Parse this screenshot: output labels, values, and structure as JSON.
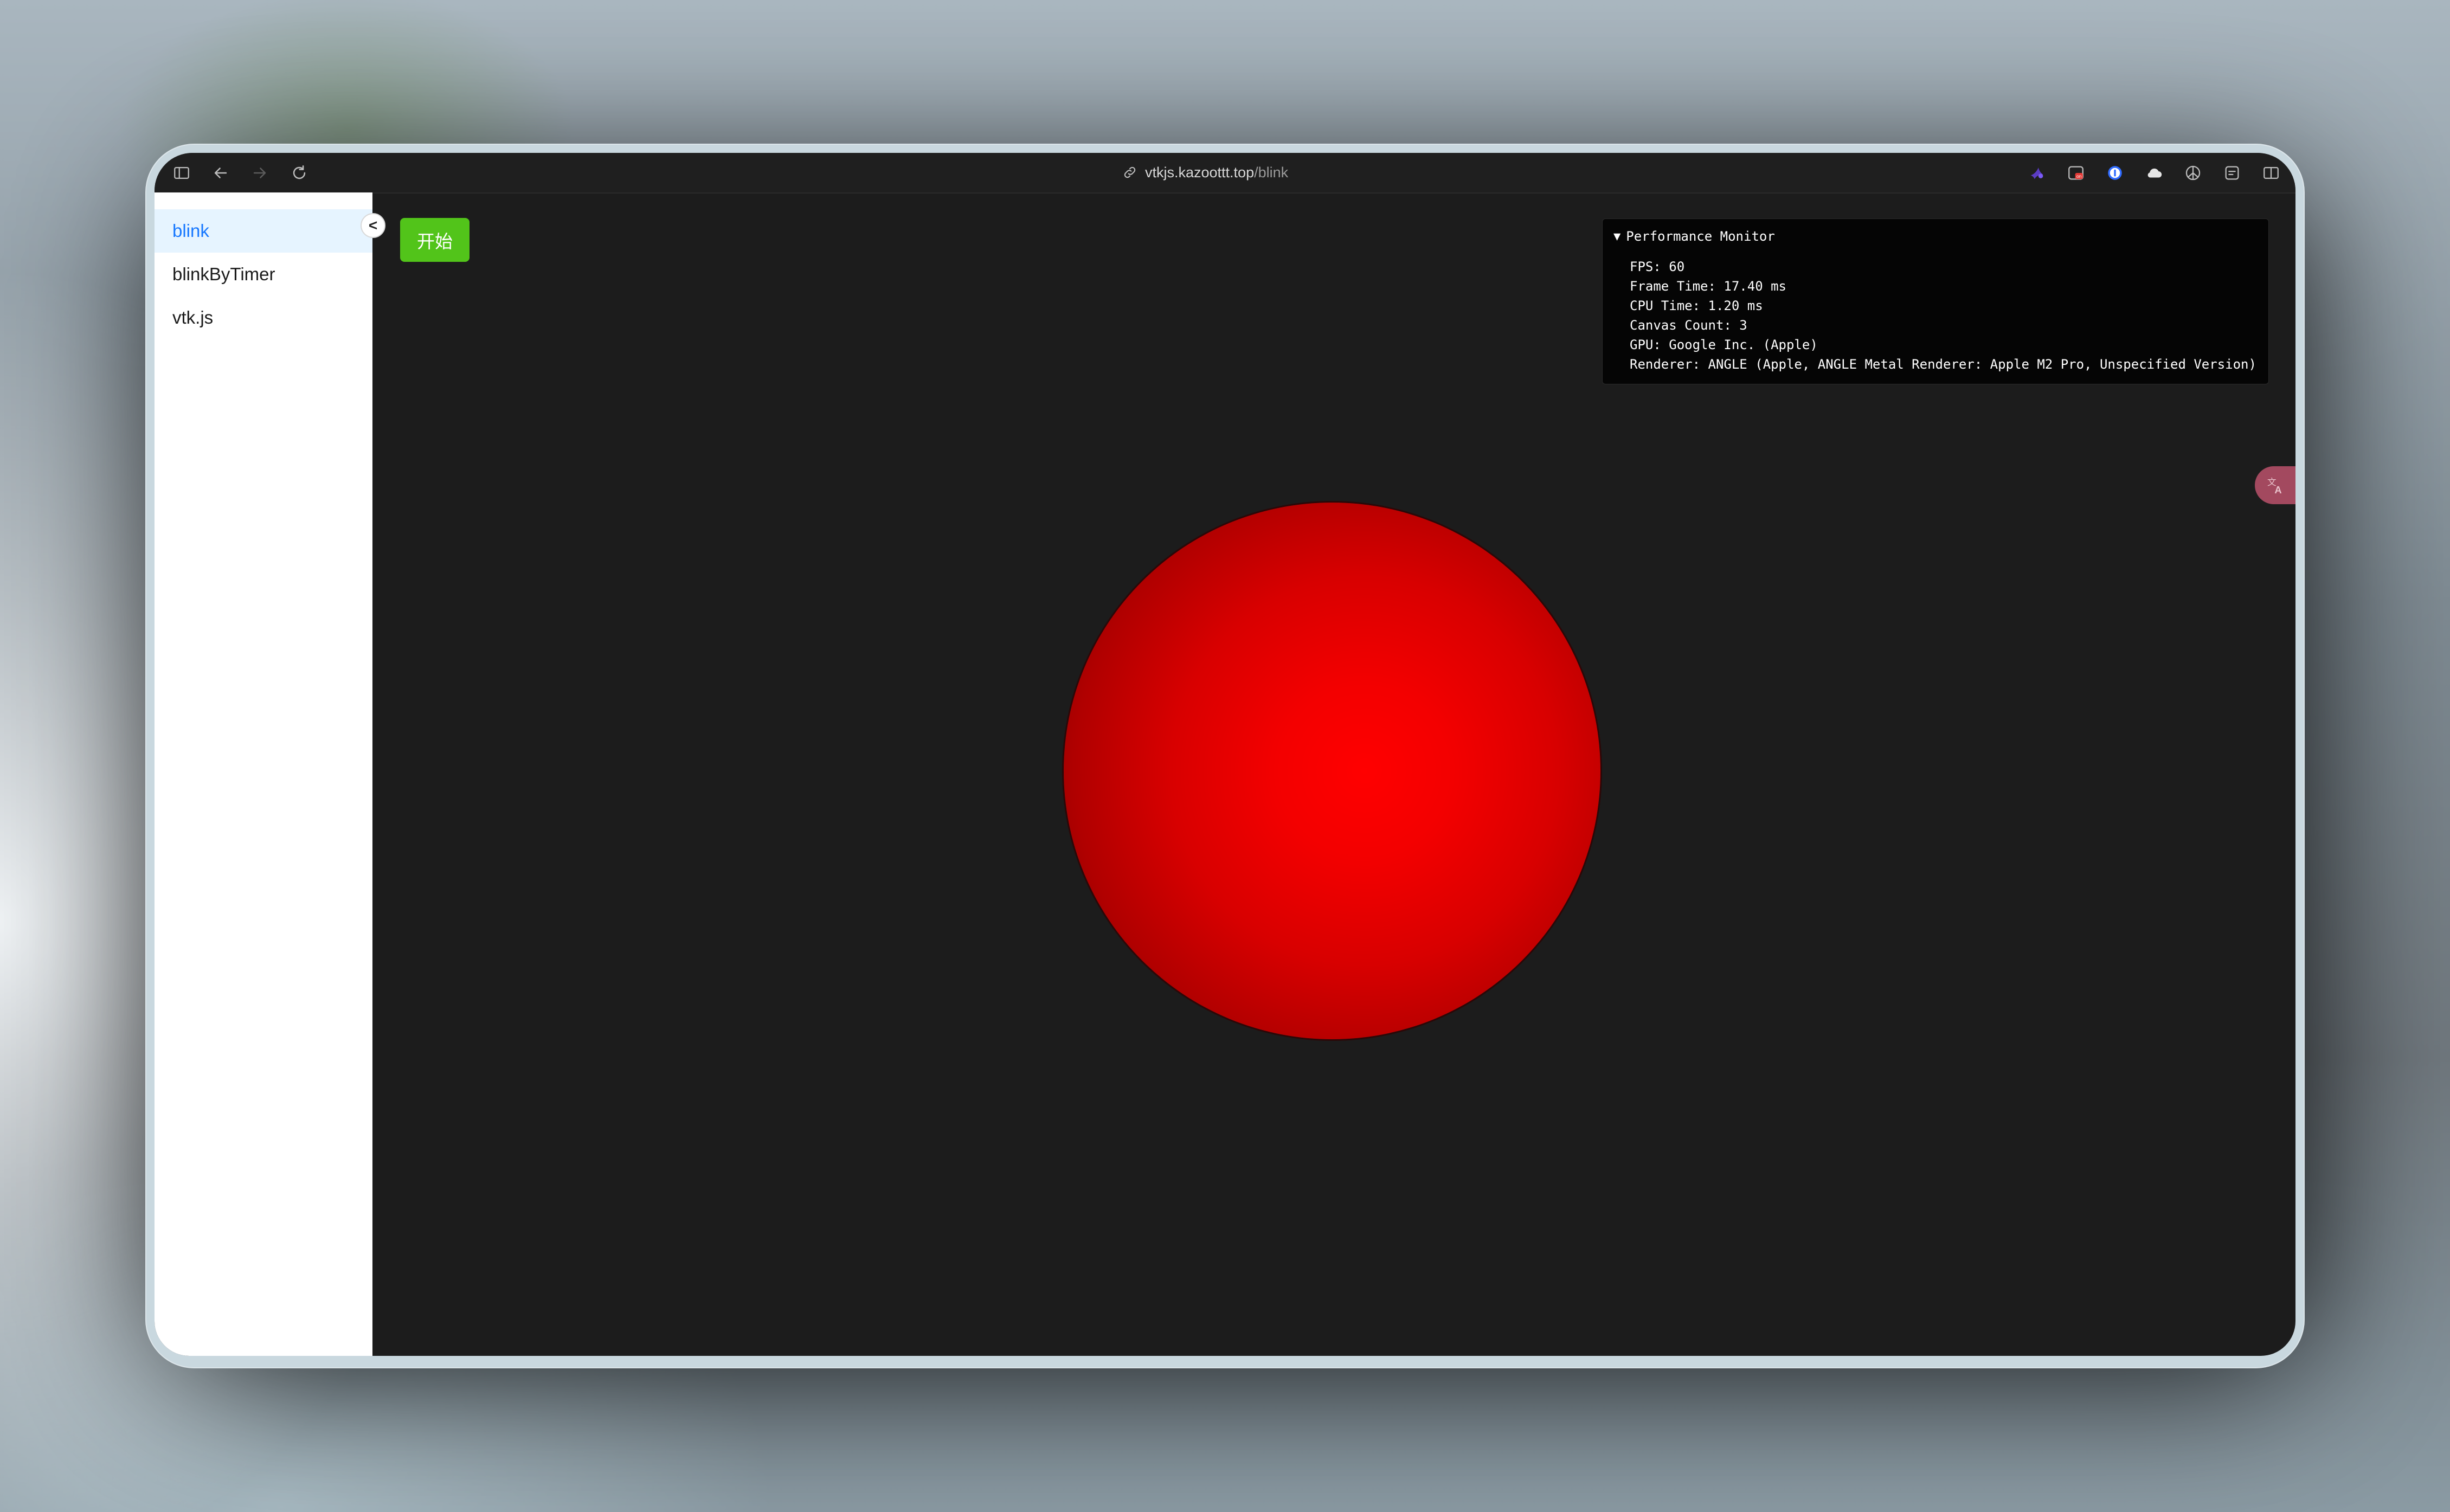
{
  "browser": {
    "url_host": "vtkjs.kazoottt.top",
    "url_path": "/blink",
    "toolbar_icons": [
      "sidebar-toggle-icon",
      "back-arrow-icon",
      "forward-arrow-icon",
      "reload-icon",
      "extension-purple-icon",
      "extension-red-badge-icon",
      "password-manager-icon",
      "cloud-icon",
      "extension-circle-icon",
      "reader-icon",
      "split-view-icon"
    ]
  },
  "sidebar": {
    "collapse_label": "<",
    "items": [
      {
        "label": "blink",
        "active": true
      },
      {
        "label": "blinkByTimer",
        "active": false
      },
      {
        "label": "vtk.js",
        "active": false
      }
    ]
  },
  "main": {
    "start_button": "开始",
    "object_color": "#ff0000"
  },
  "perf": {
    "title": "Performance Monitor",
    "fps": "FPS: 60",
    "frame_time": "Frame Time: 17.40 ms",
    "cpu_time": "CPU Time: 1.20 ms",
    "canvas_count": "Canvas Count: 3",
    "gpu": "GPU: Google Inc. (Apple)",
    "renderer": "Renderer: ANGLE (Apple, ANGLE Metal Renderer: Apple M2 Pro, Unspecified Version)"
  },
  "colors": {
    "active_menu_bg": "#e6f4ff",
    "active_menu_text": "#1677ff",
    "start_button_bg": "#52c41a",
    "canvas_bg": "#1c1c1c"
  }
}
